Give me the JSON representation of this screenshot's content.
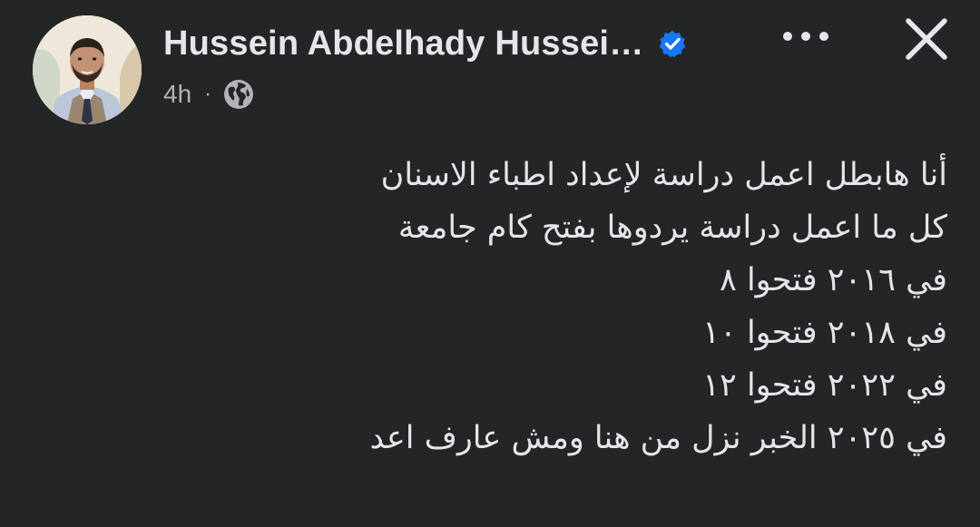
{
  "post": {
    "author_name": "Hussein Abdelhady Hussei…",
    "verified": true,
    "timestamp": "4h",
    "separator": "·",
    "audience_icon": "globe-icon",
    "more_icon": "more-options-icon",
    "close_icon": "close-icon",
    "body_lines": [
      "أنا هابطل اعمل دراسة لإعداد اطباء الاسنان",
      "كل ما اعمل دراسة يردوها بفتح كام جامعة",
      "في ٢٠١٦ فتحوا ٨",
      "في ٢٠١٨ فتحوا ١٠",
      "في ٢٠٢٢  فتحوا ١٢",
      "في ٢٠٢٥ الخبر نزل من هنا ومش عارف اعد"
    ]
  },
  "colors": {
    "background": "#242526",
    "primary_text": "#e4e6eb",
    "secondary_text": "#b0b3b8",
    "verified_badge": "#1877f2"
  }
}
